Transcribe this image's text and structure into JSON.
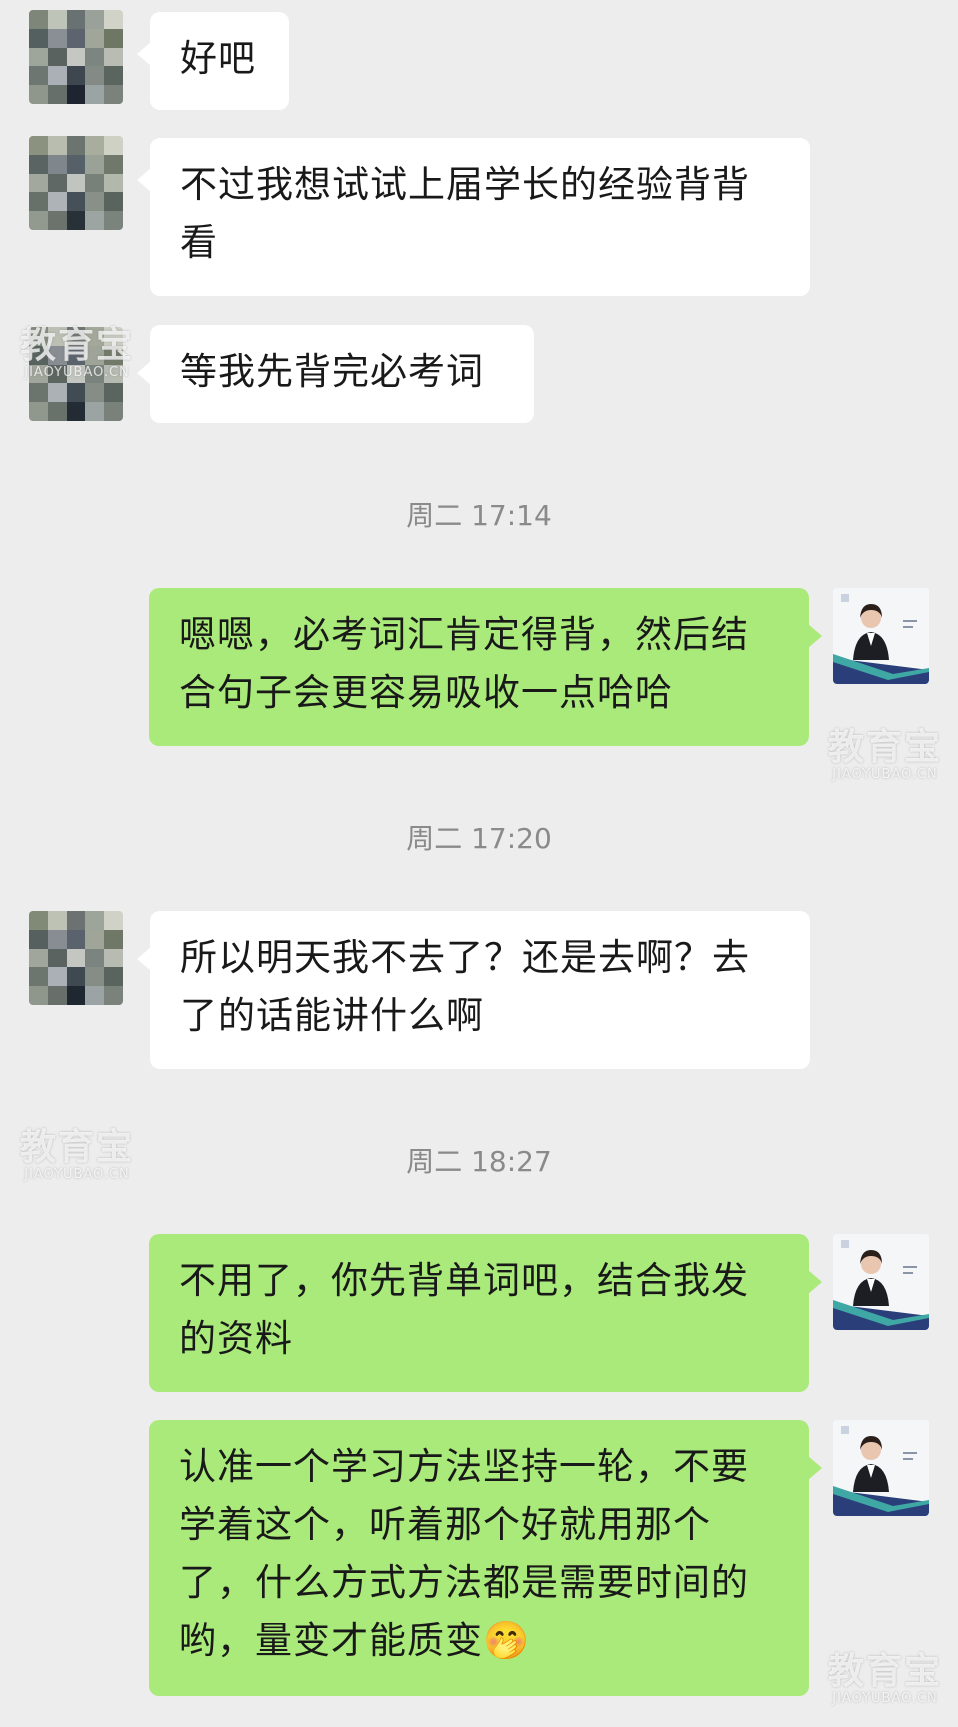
{
  "messages": [
    {
      "side": "left",
      "text": "好吧"
    },
    {
      "side": "left",
      "text": "不过我想试试上届学长的经验背背看"
    },
    {
      "side": "left",
      "text": "等我先背完必考词"
    },
    {
      "side": "right",
      "text": "嗯嗯，必考词汇肯定得背，然后结合句子会更容易吸收一点哈哈"
    },
    {
      "side": "left",
      "text": "所以明天我不去了？还是去啊？去了的话能讲什么啊"
    },
    {
      "side": "right",
      "text": "不用了，你先背单词吧，结合我发的资料"
    },
    {
      "side": "right",
      "text": "认准一个学习方法坚持一轮，不要学着这个，听着那个好就用那个了，什么方式方法都是需要时间的哟，量变才能质变",
      "emoji": "🤭"
    }
  ],
  "timestamps": [
    "周二 17:14",
    "周二 17:20",
    "周二 18:27"
  ],
  "watermark": {
    "main": "教育宝",
    "sub": "JIAOYUBAO.CN"
  },
  "colors": {
    "background": "#ededed",
    "left_bubble": "#ffffff",
    "right_bubble": "#a9ea7a"
  },
  "icons": {
    "contact_avatar": "pixelated-avatar-icon",
    "self_avatar": "teacher-profile-avatar-icon"
  }
}
